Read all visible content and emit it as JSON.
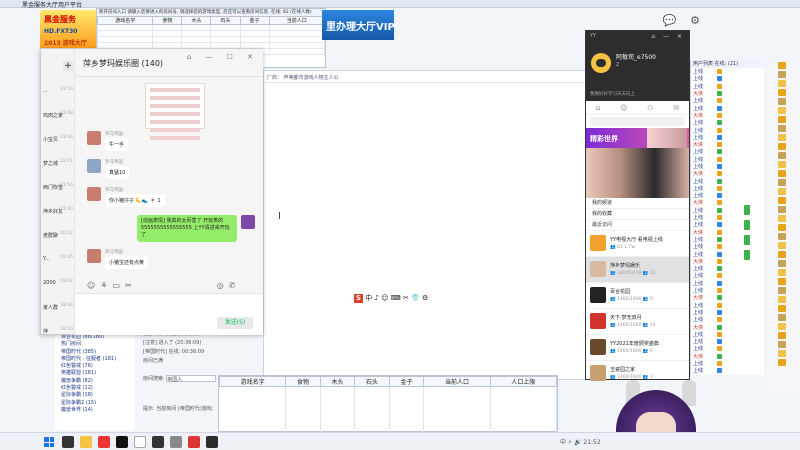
{
  "bg": {
    "title": "黑金服务大厅用户平台",
    "logo": {
      "line1": "黑金服务",
      "line2": "HD.FXT30",
      "line3": "2013 游戏大厅"
    },
    "vip_banner": "里办理大厅VIP",
    "mid_header": "厂商：  芦苇都市游戏人物主人公",
    "mini_table": {
      "title": "新开房间入口 请输入您要进入的房间号, 请选择您的游戏类型, 您还可以查看房间信息. 在线: 82 (在线人数)",
      "headers": [
        "游戏名字",
        "食物",
        "木头",
        "石头",
        "金子",
        "当前人口"
      ]
    },
    "big_table": {
      "headers": [
        "游戏名字",
        "食物",
        "木头",
        "石头",
        "金子",
        "当前人口",
        "人口上限"
      ]
    },
    "rooms": [
      "百合花园 (88/180)",
      "热门房间",
      "帝国时代 (385)",
      "帝国时代 - 征服者 (181)",
      "红色警戒 (76)",
      "英雄联盟 (181)",
      "魔兽争霸 (82)",
      "红色警戒 (12)",
      "星际争霸 (18)",
      "星际争霸2 (15)",
      "魔兽世界 (14)"
    ],
    "bottom_info": [
      "注意: 请不要在房间内刷屏",
      "[注意] 进入了 (20:36:09)",
      "[帝国时代] 在线: 00:36:09",
      "房间已满"
    ],
    "bottom_search_label": "房间搜索:",
    "bottom_search_value": "帝国人",
    "bottom_link": "提示: 当前房间 (帝国时代)游戏:"
  },
  "chat": {
    "title": "萍乡梦玛娱乐圈 (140)",
    "send_label": "发送(S)",
    "conversations": [
      {
        "name": "...",
        "time": "23:53"
      },
      {
        "name": "鸡肉之家",
        "time": "23:48"
      },
      {
        "name": "小宝贝",
        "time": "23:44"
      },
      {
        "name": "梦之城",
        "time": "22:01"
      },
      {
        "name": "西门吹雪",
        "time": "21:56"
      },
      {
        "name": "萍乡好友",
        "time": "21:30"
      },
      {
        "name": "老群聊",
        "time": "20:12"
      },
      {
        "name": "Y...",
        "time": "19:45"
      },
      {
        "name": "2000",
        "time": "19:02"
      },
      {
        "name": "家人群",
        "time": "18:44"
      },
      {
        "name": "萍",
        "time": "18:20"
      }
    ],
    "messages": [
      {
        "name": "罗马帝国",
        "text": "牛一手"
      },
      {
        "name": "罗马帝国",
        "text": "真猛10"
      },
      {
        "name": "罗马帝国",
        "text": "你小猪仔子 🦶👟 🍷 1"
      },
      {
        "name": "",
        "text": "[动画表情] 我真的太厉害了 开玩笑的 5555555555555555 上YY请进来开玩了"
      },
      {
        "name": "罗马帝国",
        "text": "小猪宝还有点黄"
      }
    ]
  },
  "yy": {
    "top_label": "YY",
    "name": "阿敖司_e7500",
    "level": "2",
    "signature": "我要好好学习天天向上",
    "banner": "精彩世界",
    "menu": [
      "我的频道",
      "我的收藏",
      "最近访问"
    ],
    "rooms": [
      {
        "name": "YY电视大厅·看电视上线",
        "meta": "👥 83  1.7w"
      },
      {
        "name": "萍乡梦玛娱乐",
        "meta": "👥 140/50178  👥 11"
      },
      {
        "name": "百合花园",
        "meta": "👥 1460/1600  👥 0"
      },
      {
        "name": "天下·梦无双月",
        "meta": "👥 1460/1600  👥 14"
      },
      {
        "name": "YY2021年度颁奖盛典",
        "meta": "👥 1460/1600  👥 0"
      },
      {
        "name": "玉瓷园之家",
        "meta": "👥 1460/1600  👥 3"
      }
    ]
  },
  "user_list": {
    "header": "用户列表 在线: (21)",
    "rows": [
      {
        "st": "上线"
      },
      {
        "st": "上线"
      },
      {
        "st": "上线"
      },
      {
        "st": "大侠"
      },
      {
        "st": "上线"
      },
      {
        "st": "上线"
      },
      {
        "st": "大侠"
      },
      {
        "st": "上线"
      },
      {
        "st": "上线"
      },
      {
        "st": "上线"
      },
      {
        "st": "大侠"
      },
      {
        "st": "上线"
      },
      {
        "st": "上线"
      },
      {
        "st": "上线"
      },
      {
        "st": "大侠"
      },
      {
        "st": "上线"
      },
      {
        "st": "上线"
      },
      {
        "st": "上线"
      },
      {
        "st": "大侠"
      },
      {
        "st": "上线"
      },
      {
        "st": "上线"
      },
      {
        "st": "上线"
      },
      {
        "st": "大侠"
      },
      {
        "st": "上线"
      },
      {
        "st": "上线"
      },
      {
        "st": "上线"
      },
      {
        "st": "大侠"
      },
      {
        "st": "上线"
      },
      {
        "st": "上线"
      },
      {
        "st": "上线"
      },
      {
        "st": "上线"
      },
      {
        "st": "大侠"
      },
      {
        "st": "上线"
      },
      {
        "st": "上线"
      },
      {
        "st": "上线"
      },
      {
        "st": "大侠"
      },
      {
        "st": "上线"
      },
      {
        "st": "上线"
      },
      {
        "st": "上线"
      },
      {
        "st": "大侠"
      },
      {
        "st": "上线"
      },
      {
        "st": "上线"
      }
    ]
  },
  "taskbar": {
    "tray_text": "中 ⚡ 🔊 21:52"
  },
  "colors": {
    "wechat_green": "#95ec69",
    "yy_dark": "#2d2d2d",
    "accent_blue": "#1658a8"
  }
}
